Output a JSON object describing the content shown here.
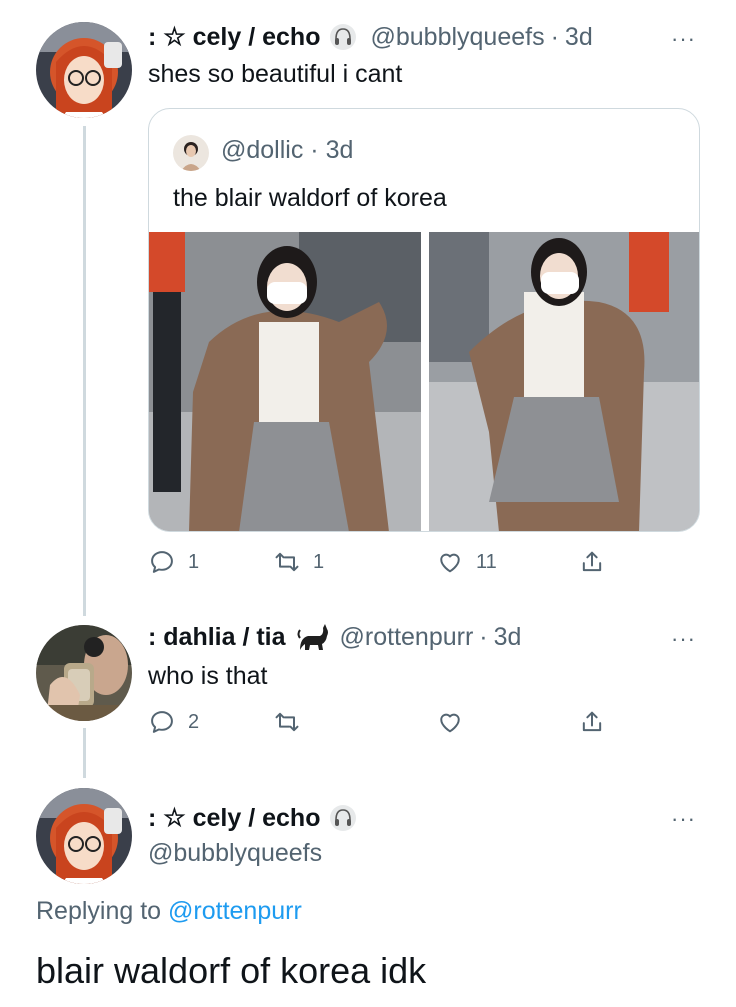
{
  "tweet1": {
    "display_name": ": ☆ cely / echo",
    "handle": "@bubblyqueefs",
    "time": "3d",
    "text": "shes so beautiful i cant",
    "more": "···",
    "quote": {
      "handle": "@dollic",
      "time": "3d",
      "text": "the blair waldorf of korea"
    },
    "actions": {
      "replies": "1",
      "retweets": "1",
      "likes": "11"
    }
  },
  "tweet2": {
    "display_name": ": dahlia / tia",
    "emoji": "🐈‍⬛",
    "handle": "@rottenpurr",
    "time": "3d",
    "text": "who is that",
    "more": "···",
    "actions": {
      "replies": "2",
      "retweets": "",
      "likes": ""
    }
  },
  "tweet3": {
    "display_name": ": ☆ cely / echo",
    "handle": "@bubblyqueefs",
    "more": "···",
    "replying_prefix": "Replying to ",
    "replying_to": "@rottenpurr",
    "text": "blair waldorf of korea idk"
  },
  "colors": {
    "text_primary": "#0f1419",
    "text_secondary": "#536471",
    "link": "#1d9bf0",
    "border": "#cfd9de"
  },
  "icons": [
    "headphones-icon",
    "cat-emoji",
    "reply-icon",
    "retweet-icon",
    "like-icon",
    "share-icon",
    "more-icon"
  ]
}
